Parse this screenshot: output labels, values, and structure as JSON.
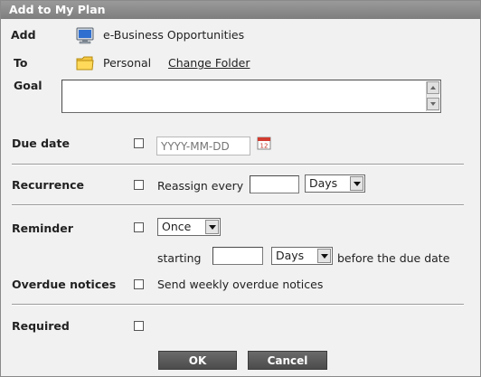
{
  "window": {
    "title": "Add to My Plan"
  },
  "add": {
    "label": "Add",
    "item": "e-Business Opportunities",
    "icon": "monitor-icon"
  },
  "to": {
    "label": "To",
    "folder": "Personal",
    "change_link": "Change Folder",
    "icon": "folder-icon"
  },
  "goal": {
    "label": "Goal",
    "value": ""
  },
  "due_date": {
    "label": "Due date",
    "checked": false,
    "placeholder": "YYYY-MM-DD",
    "icon": "calendar-icon",
    "calendar_day": "12"
  },
  "recurrence": {
    "label": "Recurrence",
    "checked": false,
    "text": "Reassign every",
    "value": "",
    "unit": "Days"
  },
  "reminder": {
    "label": "Reminder",
    "checked": false,
    "frequency": "Once",
    "starting_label": "starting",
    "starting_value": "",
    "unit": "Days",
    "suffix": "before the due date"
  },
  "overdue": {
    "label": "Overdue notices",
    "checked": false,
    "text": "Send weekly overdue notices"
  },
  "required": {
    "label": "Required",
    "checked": false
  },
  "buttons": {
    "ok": "OK",
    "cancel": "Cancel"
  },
  "colors": {
    "titlebar": "#8a8a8a",
    "background": "#f1f1f1",
    "button": "#5a5a5a"
  }
}
